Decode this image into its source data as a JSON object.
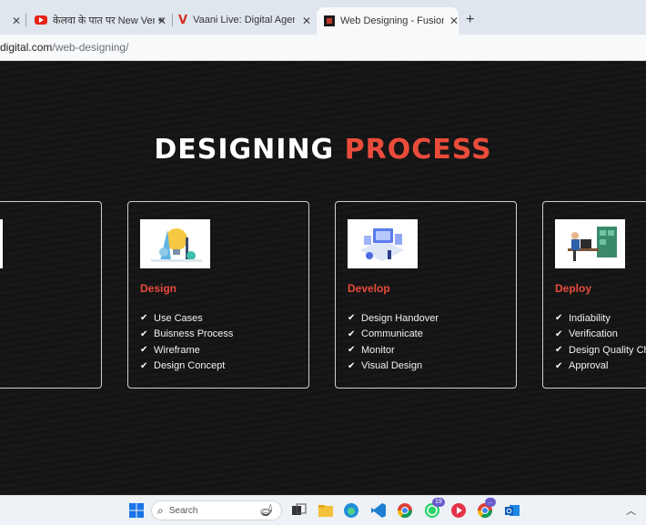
{
  "browser": {
    "tabs": [
      {
        "title": "केलवा के पात पर New Version",
        "icon": "youtube-icon",
        "audio": true
      },
      {
        "title": "Vaani Live: Digital Agency, Web",
        "icon": "vaani-icon"
      },
      {
        "title": "Web Designing - Fusionfame Di",
        "icon": "fusionfame-icon",
        "active": true
      }
    ],
    "url_host": "digital.com",
    "url_path": "/web-designing/"
  },
  "page": {
    "heading_white": "DESIGNING",
    "heading_red": "PROCESS",
    "cards": [
      {
        "title": "Design",
        "image": "design-illustration",
        "items": [
          "Use Cases",
          "Buisness Process",
          "Wireframe",
          "Design Concept"
        ]
      },
      {
        "title": "Develop",
        "image": "develop-illustration",
        "items": [
          "Design Handover",
          "Communicate",
          "Monitor",
          "Visual Design"
        ]
      },
      {
        "title": "Deploy",
        "image": "deploy-illustration",
        "items": [
          "Indiability",
          "Verification",
          "Design Quality Ch",
          "Approval"
        ]
      }
    ]
  },
  "taskbar": {
    "search_placeholder": "Search",
    "whatsapp_badge": "19",
    "chrome_badge": "..."
  },
  "colors": {
    "accent_red": "#ea4c3b",
    "page_bg": "#141414"
  }
}
